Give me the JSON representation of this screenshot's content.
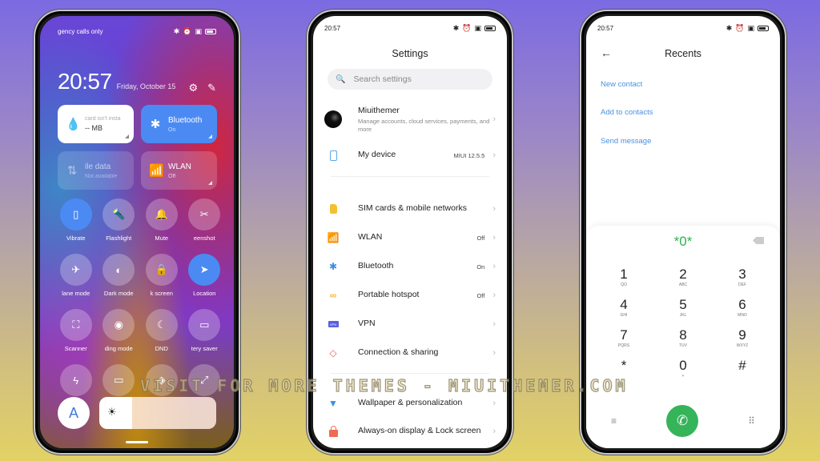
{
  "watermark": "VISIT FOR MORE THEMES - MIUITHEMER.COM",
  "control_center": {
    "status_text": "gency calls only",
    "status_icons": [
      "bluetooth-icon",
      "alarm-icon",
      "sim-icon",
      "battery-icon"
    ],
    "time": "20:57",
    "date": "Friday, October 15",
    "header_icons": [
      "settings-icon",
      "edit-icon"
    ],
    "tiles": [
      {
        "id": "data-usage",
        "title": "card isn't insta",
        "sub": "-- MB",
        "icon": "drop-icon",
        "state": "white"
      },
      {
        "id": "bluetooth",
        "title": "Bluetooth",
        "sub": "On",
        "icon": "bluetooth-icon",
        "state": "on"
      },
      {
        "id": "mobile-data",
        "title": "ile data",
        "sub": "Not available",
        "icon": "arrows-updown-icon",
        "state": "disabled"
      },
      {
        "id": "wlan",
        "title": "WLAN",
        "sub": "Off",
        "icon": "wifi-icon",
        "state": "off"
      }
    ],
    "toggles": [
      {
        "label": "Vibrate",
        "icon": "vibrate-icon",
        "glyph": "▯",
        "on": true
      },
      {
        "label": "Flashlight",
        "icon": "flashlight-icon",
        "glyph": "🔦",
        "on": false
      },
      {
        "label": "Mute",
        "icon": "bell-icon",
        "glyph": "🔔",
        "on": false
      },
      {
        "label": "eenshot",
        "icon": "screenshot-icon",
        "glyph": "✂",
        "on": false
      },
      {
        "label": "lane mode",
        "icon": "airplane-icon",
        "glyph": "✈",
        "on": false
      },
      {
        "label": "Dark mode",
        "icon": "dark-mode-icon",
        "glyph": "◐",
        "on": false
      },
      {
        "label": "k screen",
        "icon": "lock-icon",
        "glyph": "🔒",
        "on": false
      },
      {
        "label": "Location",
        "icon": "location-icon",
        "glyph": "➤",
        "on": true
      },
      {
        "label": "Scanner",
        "icon": "scanner-icon",
        "glyph": "⛶",
        "on": false
      },
      {
        "label": "ding mode",
        "icon": "eye-icon",
        "glyph": "◉",
        "on": false
      },
      {
        "label": "DND",
        "icon": "moon-icon",
        "glyph": "☾",
        "on": false
      },
      {
        "label": "tery saver",
        "icon": "battery-saver-icon",
        "glyph": "▭",
        "on": false
      },
      {
        "label": "",
        "icon": "lightning-icon",
        "glyph": "ϟ",
        "on": false
      },
      {
        "label": "",
        "icon": "cast-icon",
        "glyph": "▭",
        "on": false
      },
      {
        "label": "",
        "icon": "sync-icon",
        "glyph": "◈",
        "on": false
      },
      {
        "label": "",
        "icon": "rotate-icon",
        "glyph": "⤢",
        "on": false
      }
    ],
    "auto_brightness_label": "A",
    "brightness_level": 0.28
  },
  "settings": {
    "status_time": "20:57",
    "title": "Settings",
    "search_placeholder": "Search settings",
    "account": {
      "name": "Miuithemer",
      "sub": "Manage accounts, cloud services, payments, and more"
    },
    "device": {
      "label": "My device",
      "value": "MIUI 12.5.5"
    },
    "items": [
      {
        "label": "SIM cards & mobile networks",
        "value": "",
        "icon": "sim-card-icon"
      },
      {
        "label": "WLAN",
        "value": "Off",
        "icon": "wifi-icon"
      },
      {
        "label": "Bluetooth",
        "value": "On",
        "icon": "bluetooth-icon"
      },
      {
        "label": "Portable hotspot",
        "value": "Off",
        "icon": "hotspot-icon"
      },
      {
        "label": "VPN",
        "value": "",
        "icon": "vpn-icon"
      },
      {
        "label": "Connection & sharing",
        "value": "",
        "icon": "connection-sharing-icon"
      },
      {
        "label": "Wallpaper & personalization",
        "value": "",
        "icon": "wallpaper-icon"
      },
      {
        "label": "Always-on display & Lock screen",
        "value": "",
        "icon": "lock-screen-icon"
      }
    ]
  },
  "dialer": {
    "status_time": "20:57",
    "title": "Recents",
    "links": [
      "New contact",
      "Add to contacts",
      "Send message"
    ],
    "number": "*0*",
    "keys": [
      {
        "d": "1",
        "l": "QO"
      },
      {
        "d": "2",
        "l": "ABC"
      },
      {
        "d": "3",
        "l": "DEF"
      },
      {
        "d": "4",
        "l": "GHI"
      },
      {
        "d": "5",
        "l": "JKL"
      },
      {
        "d": "6",
        "l": "MNO"
      },
      {
        "d": "7",
        "l": "PQRS"
      },
      {
        "d": "8",
        "l": "TUV"
      },
      {
        "d": "9",
        "l": "WXYZ"
      },
      {
        "d": "*",
        "l": ""
      },
      {
        "d": "0",
        "l": "+"
      },
      {
        "d": "#",
        "l": ""
      }
    ],
    "colors": {
      "accent": "#35b45a",
      "link": "#4a90e2"
    }
  }
}
